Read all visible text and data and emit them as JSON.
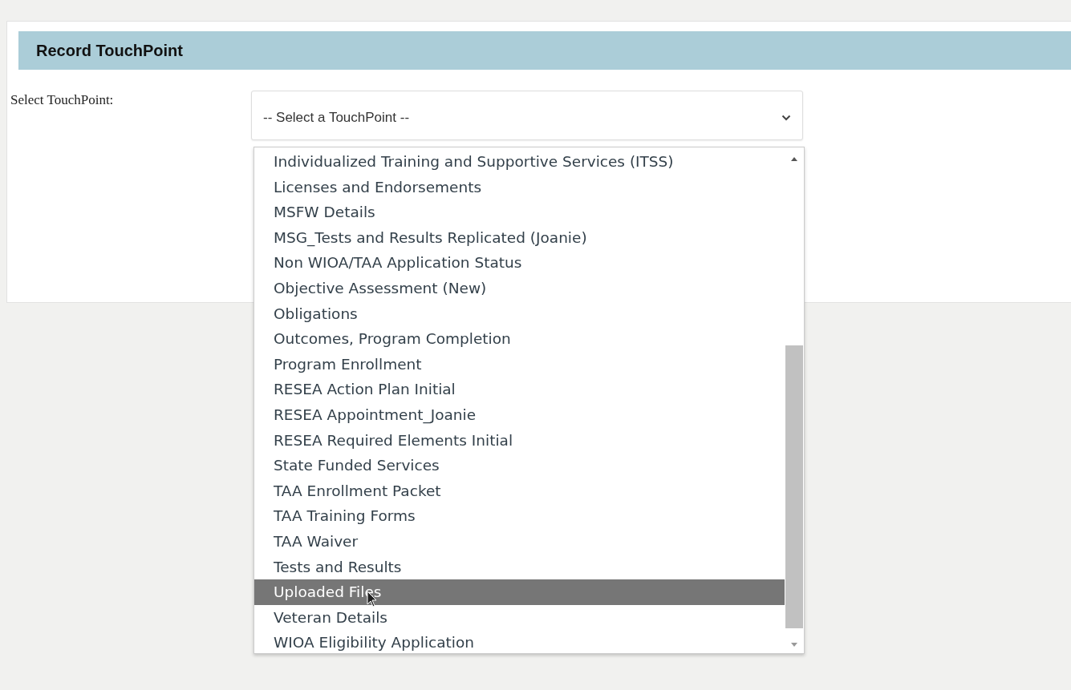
{
  "panel": {
    "title": "Record TouchPoint"
  },
  "form": {
    "label": "Select TouchPoint:",
    "select": {
      "value": "-- Select a TouchPoint --"
    }
  },
  "options": [
    {
      "label": "Individualized Training and Supportive Services (ITSS)",
      "selected": false
    },
    {
      "label": "Licenses and Endorsements",
      "selected": false
    },
    {
      "label": "MSFW Details",
      "selected": false
    },
    {
      "label": "MSG_Tests and Results Replicated (Joanie)",
      "selected": false
    },
    {
      "label": "Non WIOA/TAA Application Status",
      "selected": false
    },
    {
      "label": "Objective Assessment (New)",
      "selected": false
    },
    {
      "label": "Obligations",
      "selected": false
    },
    {
      "label": "Outcomes, Program Completion",
      "selected": false
    },
    {
      "label": "Program Enrollment",
      "selected": false
    },
    {
      "label": "RESEA Action Plan Initial",
      "selected": false
    },
    {
      "label": "RESEA Appointment_Joanie",
      "selected": false
    },
    {
      "label": "RESEA Required Elements Initial",
      "selected": false
    },
    {
      "label": "State Funded Services",
      "selected": false
    },
    {
      "label": "TAA Enrollment Packet",
      "selected": false
    },
    {
      "label": "TAA Training Forms",
      "selected": false
    },
    {
      "label": "TAA Waiver",
      "selected": false
    },
    {
      "label": "Tests and Results",
      "selected": false
    },
    {
      "label": "Uploaded Files",
      "selected": true
    },
    {
      "label": "Veteran Details",
      "selected": false
    },
    {
      "label": "WIOA Eligibility Application",
      "selected": false
    }
  ]
}
